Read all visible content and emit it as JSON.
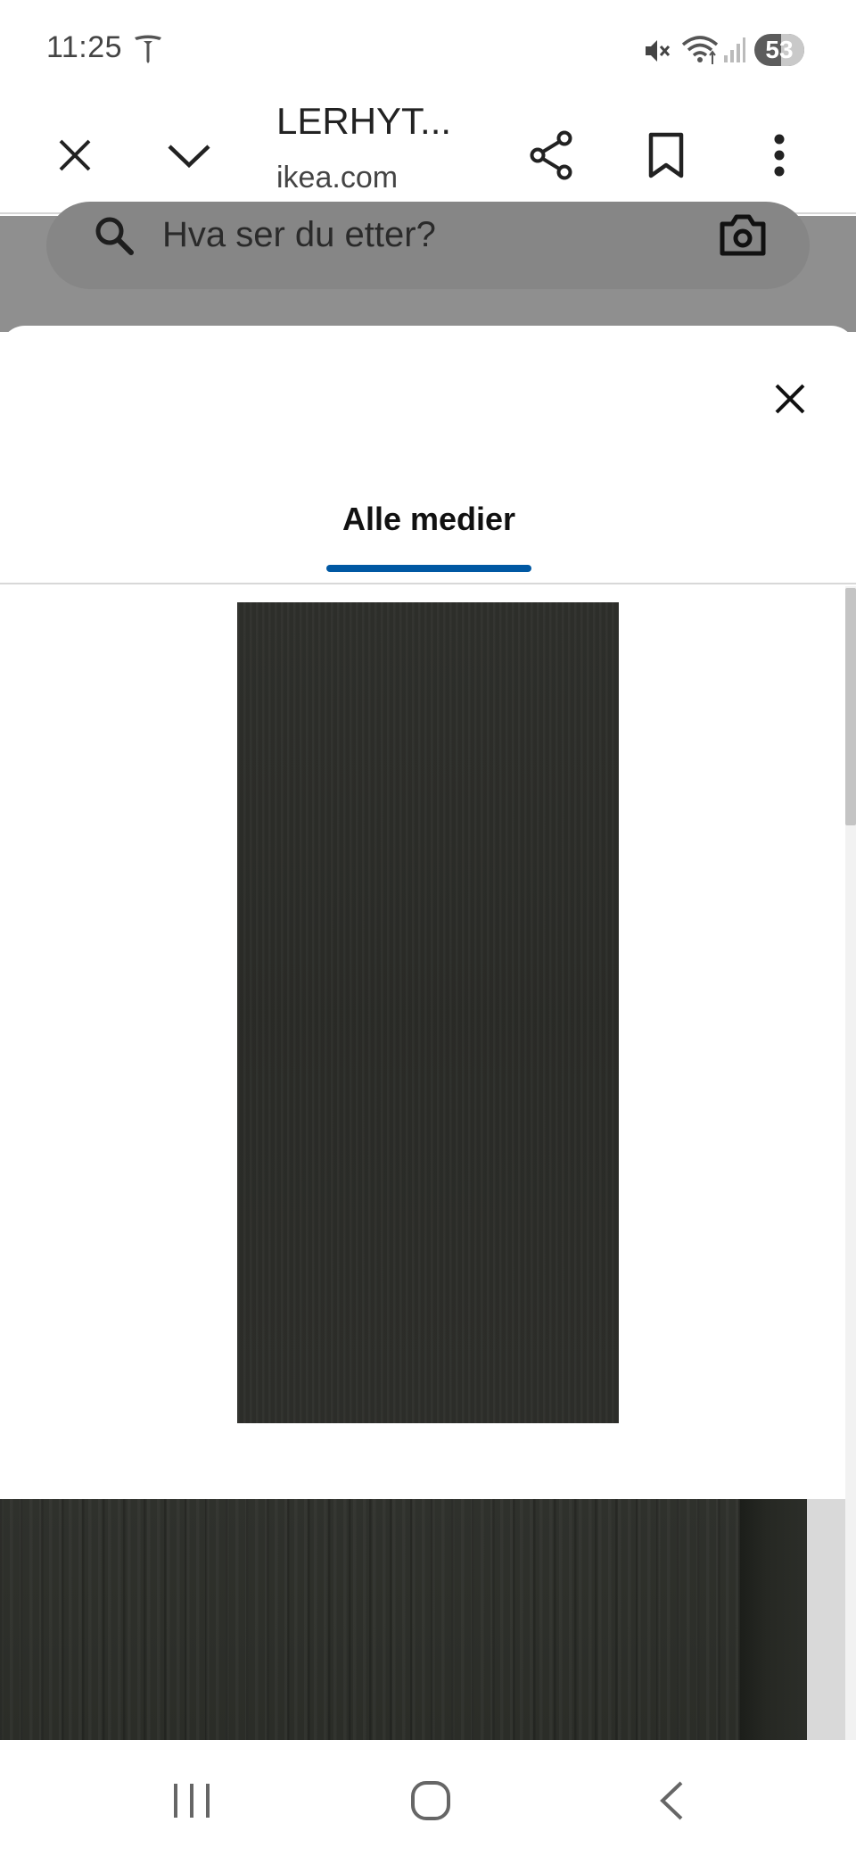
{
  "status_bar": {
    "time": "11:25",
    "battery_level": "53",
    "icons": [
      "tesla-icon",
      "mute-icon",
      "wifi-icon",
      "signal-icon"
    ]
  },
  "browser": {
    "title": "LERHYT...",
    "domain": "ikea.com",
    "buttons": [
      "close-icon",
      "chevron-down-icon",
      "share-icon",
      "bookmark-icon",
      "more-vert-icon"
    ]
  },
  "background_page": {
    "search_placeholder": "Hva ser du etter?"
  },
  "modal": {
    "tab_label": "Alle medier",
    "accent_color": "#0058a3"
  },
  "navigation_bar": {
    "buttons": [
      "recents-icon",
      "home-icon",
      "back-icon"
    ]
  }
}
